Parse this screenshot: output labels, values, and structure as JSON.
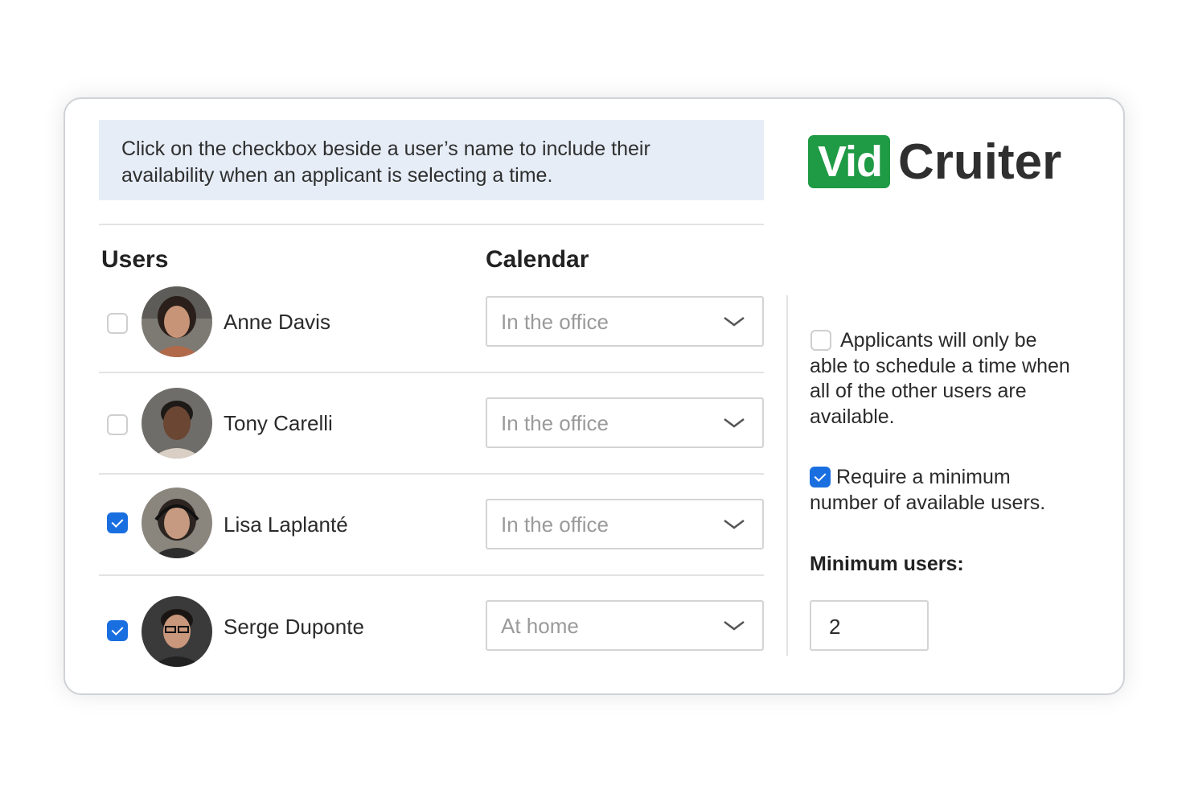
{
  "instructions": {
    "line1": "Click on the checkbox beside a user’s name to include their",
    "line2": "availability when an applicant is selecting a time."
  },
  "logo": {
    "part1": "Vid",
    "part2": "Cruiter",
    "brand_color": "#1f9a45"
  },
  "headers": {
    "users": "Users",
    "calendar": "Calendar"
  },
  "users": [
    {
      "name": "Anne Davis",
      "checked": false,
      "calendar": "In the office",
      "avatar": "avatar-photo"
    },
    {
      "name": "Tony Carelli",
      "checked": false,
      "calendar": "In the office",
      "avatar": "avatar-photo"
    },
    {
      "name": "Lisa Laplanté",
      "checked": true,
      "calendar": "In the office",
      "avatar": "avatar-photo"
    },
    {
      "name": "Serge Duponte",
      "checked": true,
      "calendar": "At home",
      "avatar": "avatar-photo"
    }
  ],
  "options": {
    "all_available": {
      "checked": false,
      "lines": [
        "Applicants will only be",
        "able to schedule a time when",
        "all of the other users are",
        "available."
      ]
    },
    "require_minimum": {
      "checked": true,
      "lines": [
        "Require a minimum",
        "number of available users."
      ]
    },
    "minimum_users_label": "Minimum users:",
    "minimum_users_value": "2"
  },
  "colors": {
    "checkbox_checked": "#1a6fe0",
    "banner_bg": "#e6edf7"
  },
  "icons": {
    "dropdown": "chevron-down-icon",
    "checkbox_checked": "checkmark-icon"
  }
}
